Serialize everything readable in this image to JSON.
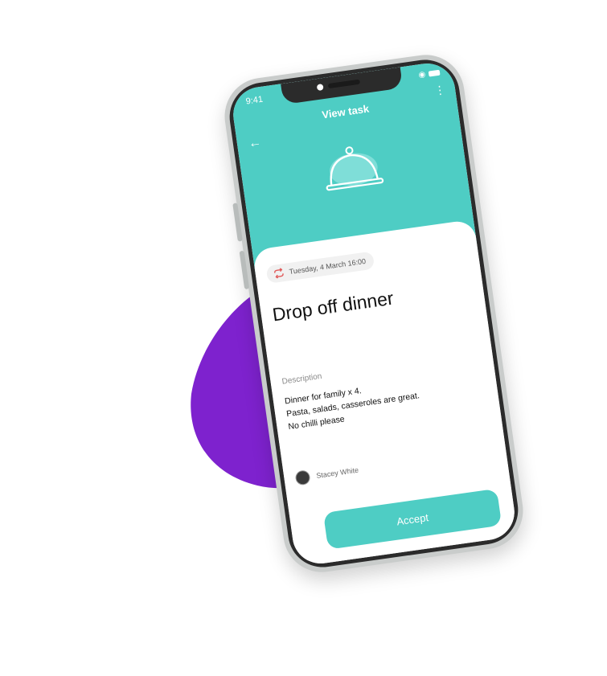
{
  "colors": {
    "accent": "#4ecdc4",
    "blob": "#7e22ce",
    "phone_frame": "#c9cccb",
    "bezel": "#2b2b2b",
    "repeat_icon": "#e05a5a"
  },
  "status_bar": {
    "time": "9:41"
  },
  "header": {
    "title": "View task",
    "back_icon": "←",
    "menu_icon": "⋮",
    "illustration": "cloche-icon"
  },
  "task": {
    "date": "Tuesday, 4 March 16:00",
    "title": "Drop off dinner",
    "description_label": "Description",
    "description_lines": [
      "Dinner for family x 4.",
      "Pasta, salads, casseroles are great.",
      "No chilli please"
    ],
    "poster_name": "Stacey White"
  },
  "actions": {
    "accept_label": "Accept"
  }
}
